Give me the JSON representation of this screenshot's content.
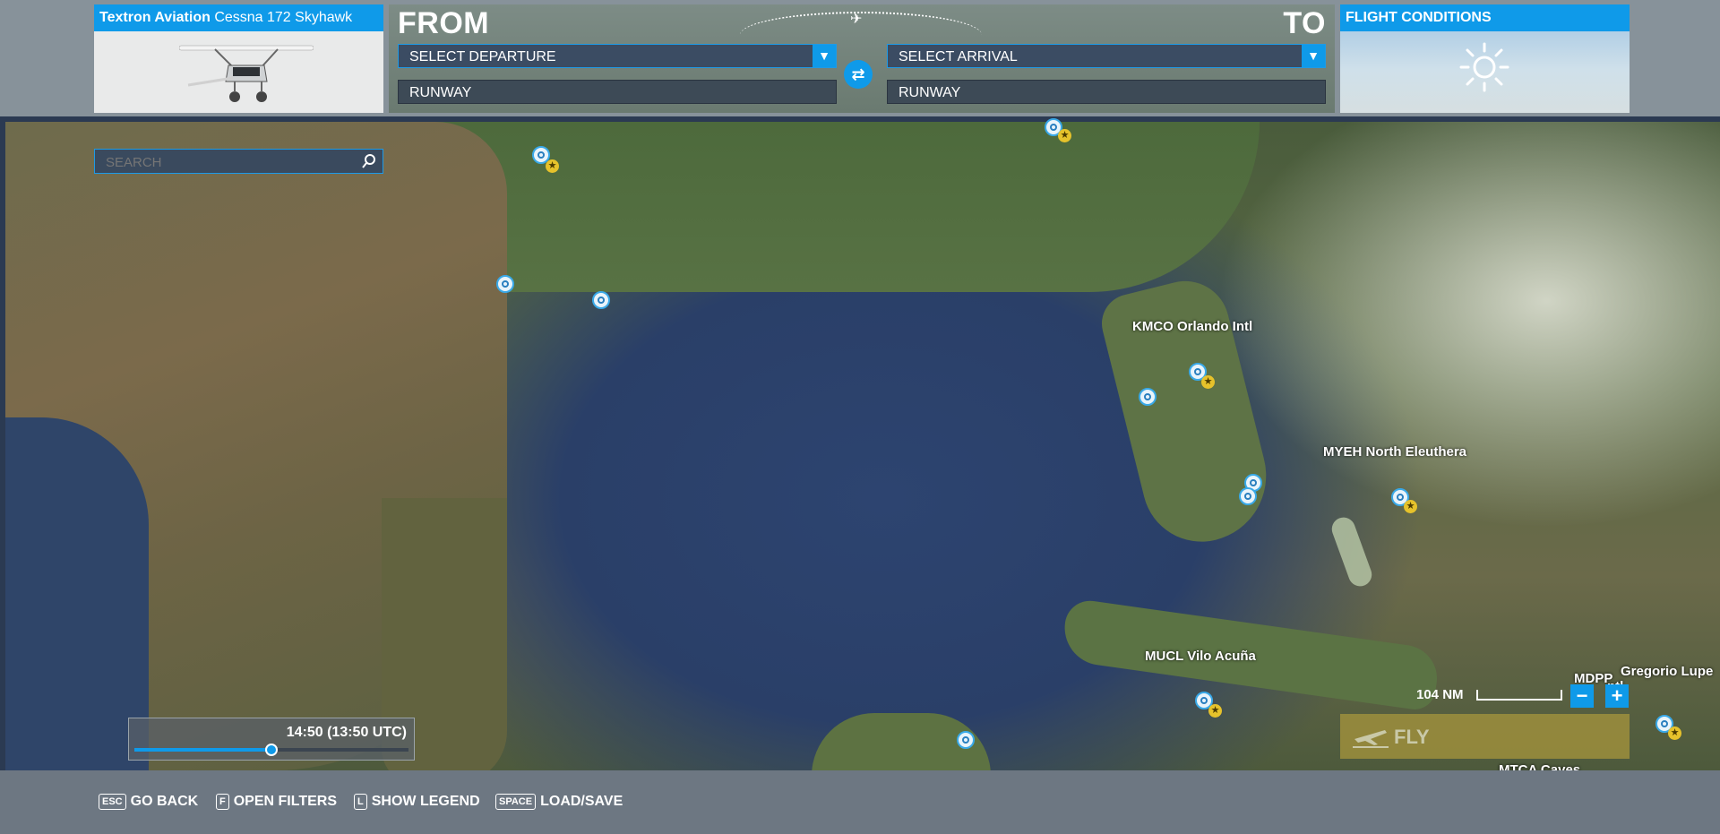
{
  "aircraft": {
    "brand": "Textron Aviation",
    "model": "Cessna 172 Skyhawk"
  },
  "route": {
    "from_label": "FROM",
    "to_label": "TO",
    "departure_value": "SELECT DEPARTURE",
    "arrival_value": "SELECT ARRIVAL",
    "departure_runway": "RUNWAY",
    "arrival_runway": "RUNWAY"
  },
  "conditions": {
    "title": "FLIGHT CONDITIONS",
    "weather_icon": "sun-icon"
  },
  "search": {
    "placeholder": "SEARCH"
  },
  "map_labels": {
    "kmco": "KMCO Orlando Intl",
    "myeh": "MYEH North Eleuthera",
    "mucl": "MUCL Vilo Acuña",
    "mdpp": "MDPP",
    "gregorio": "Gregorio Lupe",
    "intl": "ntl",
    "mtca": "MTCA Caves"
  },
  "time": {
    "display": "14:50 (13:50 UTC)",
    "position": 0.5
  },
  "scale": {
    "label": "104 NM"
  },
  "zoom": {
    "minus": "−",
    "plus": "+"
  },
  "fly": {
    "label": "FLY"
  },
  "hints": [
    {
      "key": "ESC",
      "label": "GO BACK"
    },
    {
      "key": "F",
      "label": "OPEN FILTERS"
    },
    {
      "key": "L",
      "label": "SHOW LEGEND"
    },
    {
      "key": "SPACE",
      "label": "LOAD/SAVE"
    }
  ],
  "colors": {
    "accent": "#0f9ae9",
    "star": "#e6c22b"
  }
}
